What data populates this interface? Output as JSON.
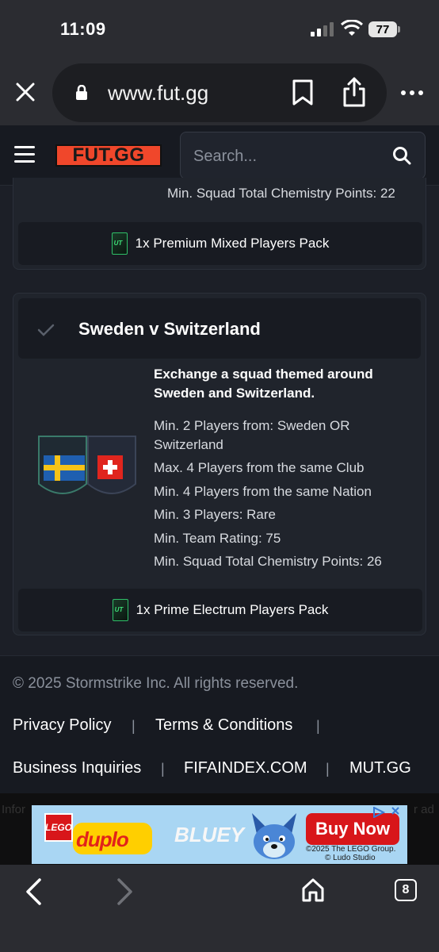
{
  "status": {
    "time": "11:09",
    "battery": "77"
  },
  "browser": {
    "url": "www.fut.gg"
  },
  "header": {
    "logo": "FUT.GG",
    "search_placeholder": "Search..."
  },
  "prev_card": {
    "last_requirement": "Min. Squad Total Chemistry Points: 22",
    "reward": "1x Premium Mixed Players Pack"
  },
  "card": {
    "title": "Sweden v Switzerland",
    "description": "Exchange a squad themed around Sweden and Switzerland.",
    "requirements": [
      "Min. 2 Players from: Sweden OR Switzerland",
      "Max. 4 Players from the same Club",
      "Min. 4 Players from the same Nation",
      "Min. 3 Players: Rare",
      "Min. Team Rating: 75",
      "Min. Squad Total Chemistry Points: 26"
    ],
    "reward": "1x Prime Electrum Players Pack"
  },
  "footer": {
    "copyright": "© 2025 Stormstrike Inc. All rights reserved.",
    "links": [
      "Privacy Policy",
      "Terms & Conditions",
      "Business Inquiries",
      "FIFAINDEX.COM",
      "MUT.GG"
    ],
    "separator": "|"
  },
  "ad": {
    "background_left": "Infor",
    "background_right": "r ad",
    "brand1": "LEGO",
    "brand2": "duplo",
    "brand3": "BLUEY",
    "cta": "Buy Now",
    "copy_line1": "©2025 The LEGO Group.",
    "copy_line2": "© Ludo Studio"
  },
  "toolbar": {
    "tabs_count": "8"
  },
  "colors": {
    "accent": "#f0472b",
    "bg": "#1c1f27",
    "card": "#20242c",
    "pack_green": "#2fbf68"
  }
}
